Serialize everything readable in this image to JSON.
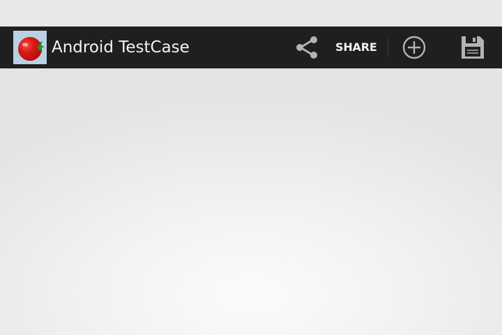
{
  "action_bar": {
    "app_title": "Android TestCase",
    "app_icon": "tomato-icon",
    "actions": {
      "share_icon": "share-icon",
      "share_label": "SHARE",
      "add_icon": "add-circle-icon",
      "save_icon": "save-floppy-icon"
    }
  },
  "colors": {
    "action_bar_bg": "#1f1f1f",
    "action_text": "#f2f2f2",
    "icon_gray": "#b3b3b3",
    "content_bg": "#f2f2f2"
  }
}
